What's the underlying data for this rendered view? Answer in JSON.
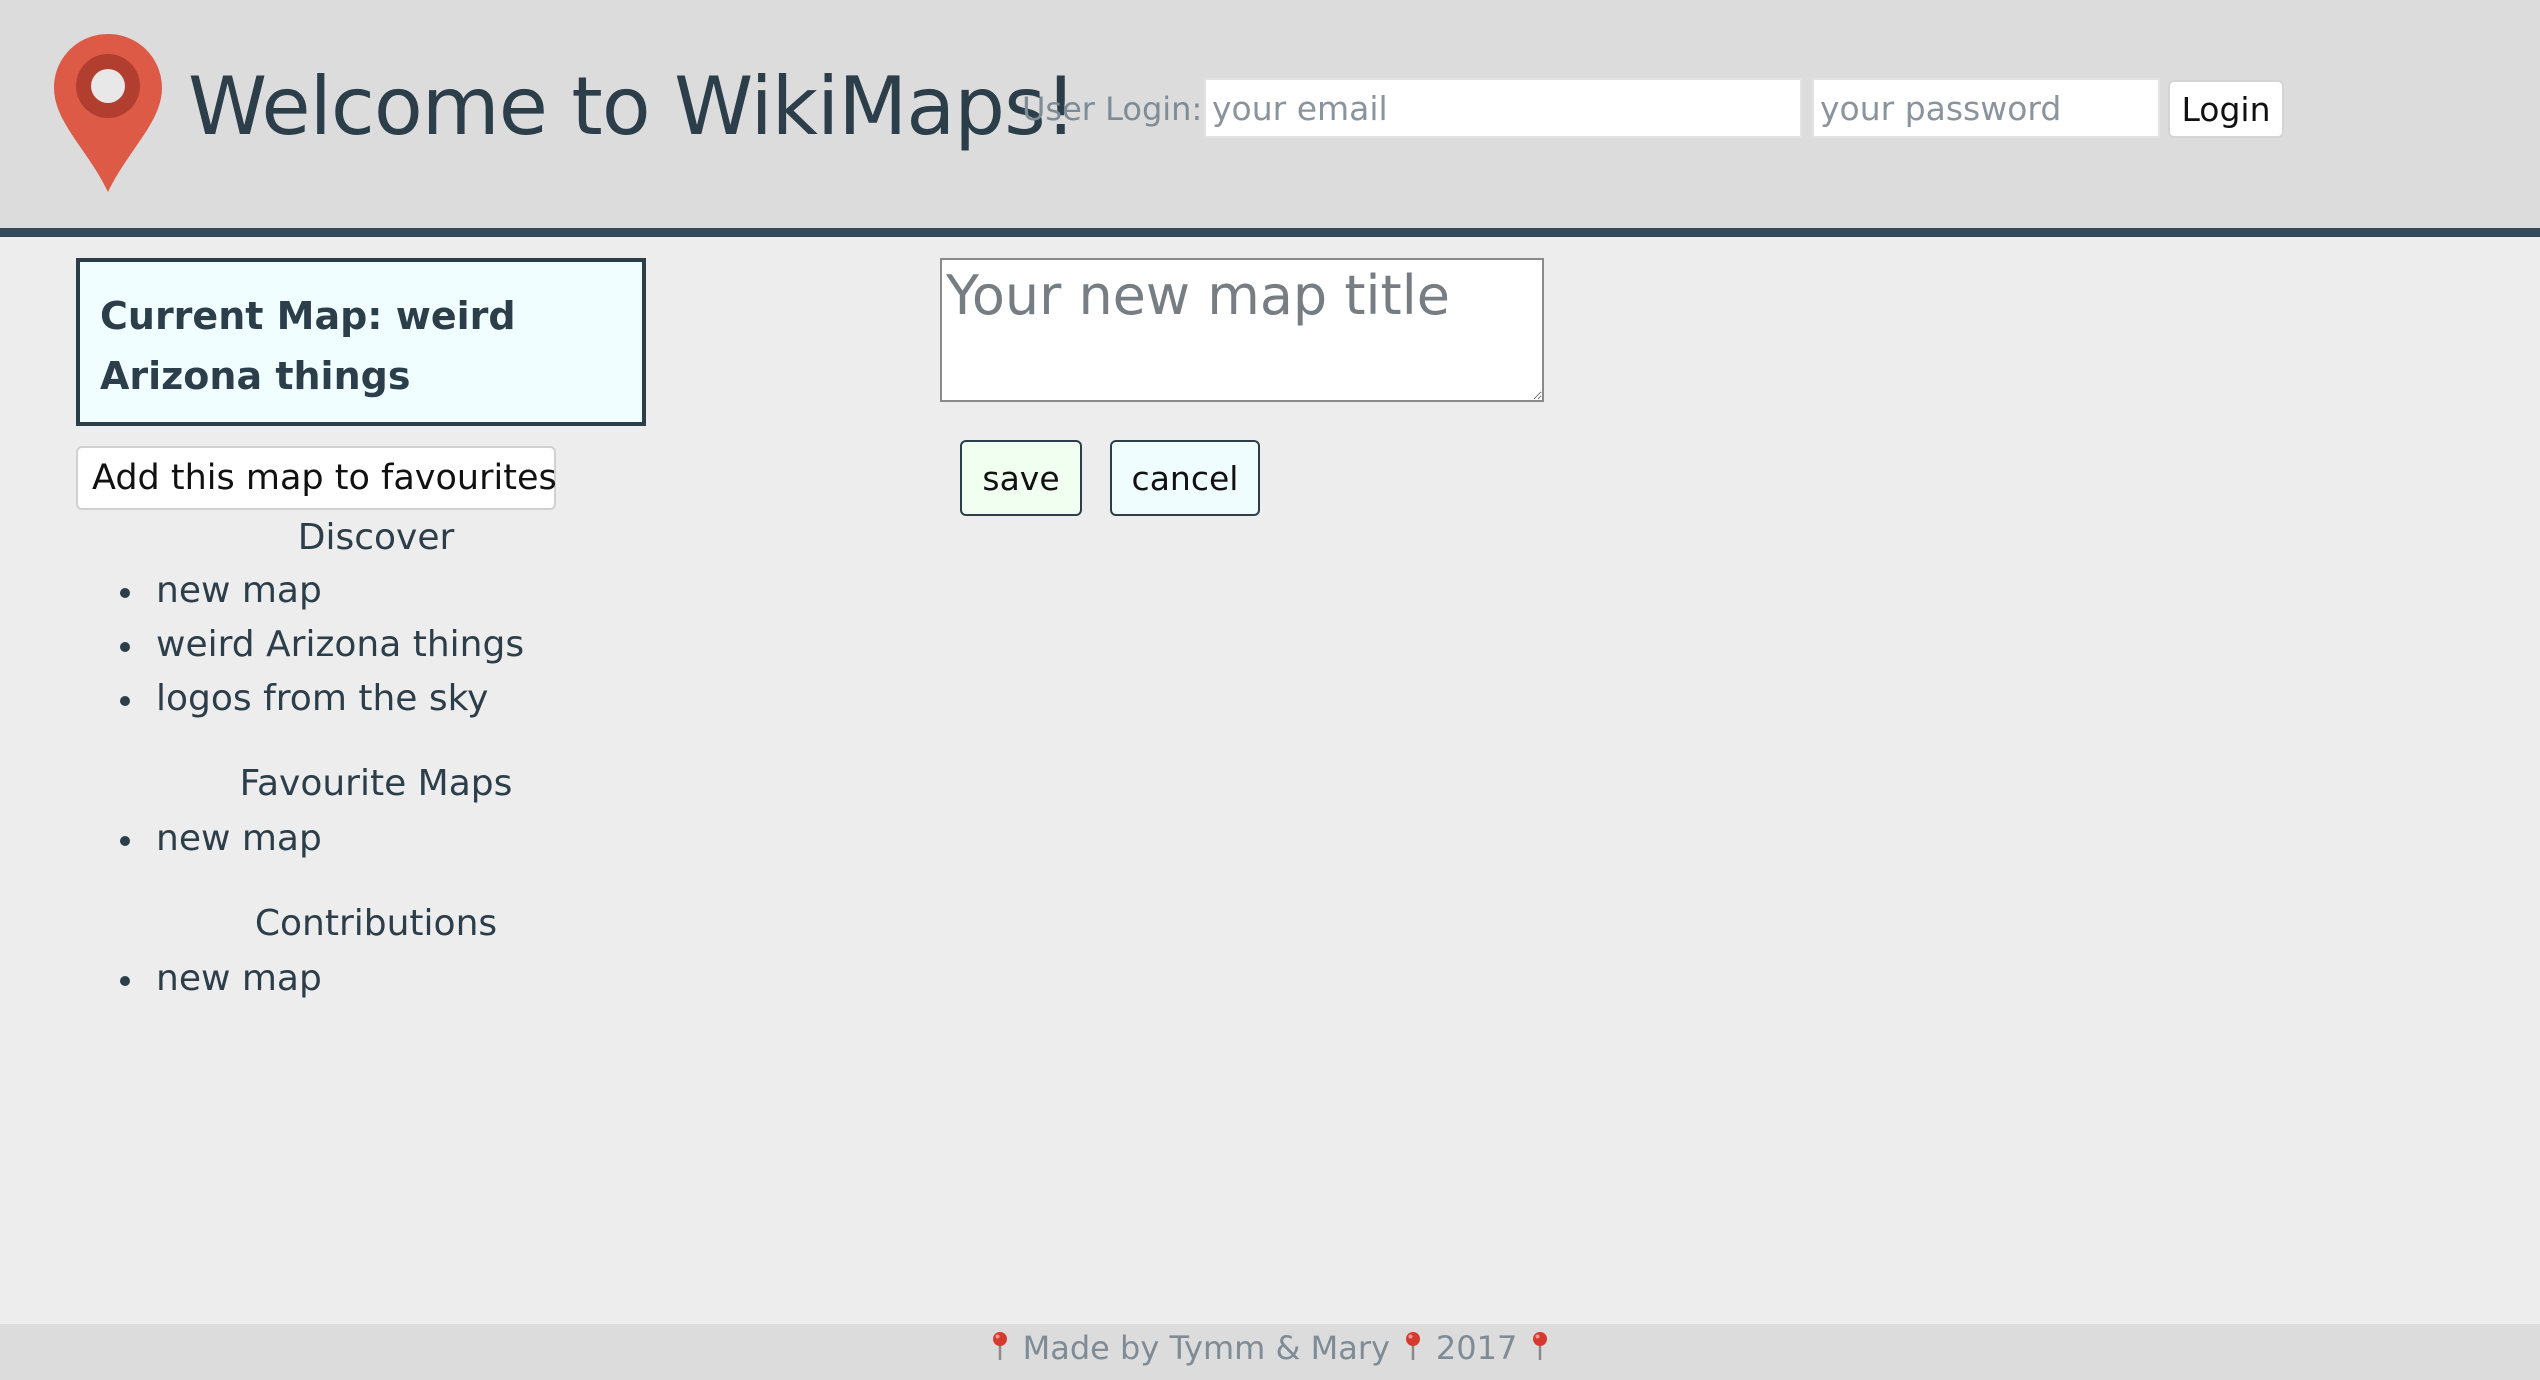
{
  "header": {
    "title": "Welcome to WikiMaps!",
    "login_label": "User Login:",
    "email_placeholder": "your email",
    "password_placeholder": "your password",
    "login_button": "Login",
    "logo_icon": "map-pin-icon",
    "colors": {
      "bar": "#dcdcdc",
      "border": "#34495a",
      "pin": "#dd5a47"
    }
  },
  "sidebar": {
    "current_map": "Current Map: weird Arizona things",
    "favourite_button": "Add this map to favourites",
    "discover": {
      "heading": "Discover",
      "items": [
        "new map",
        "weird Arizona things",
        "logos from the sky"
      ]
    },
    "favourites": {
      "heading": "Favourite Maps",
      "items": [
        "new map"
      ]
    },
    "contributions": {
      "heading": "Contributions",
      "items": [
        "new map"
      ]
    }
  },
  "editor": {
    "title_placeholder": "Your new map title",
    "save_button": "save",
    "cancel_button": "cancel"
  },
  "footer": {
    "made_by": "Made by Tymm & Mary",
    "year": "2017",
    "pin_icon": "pushpin-icon"
  }
}
